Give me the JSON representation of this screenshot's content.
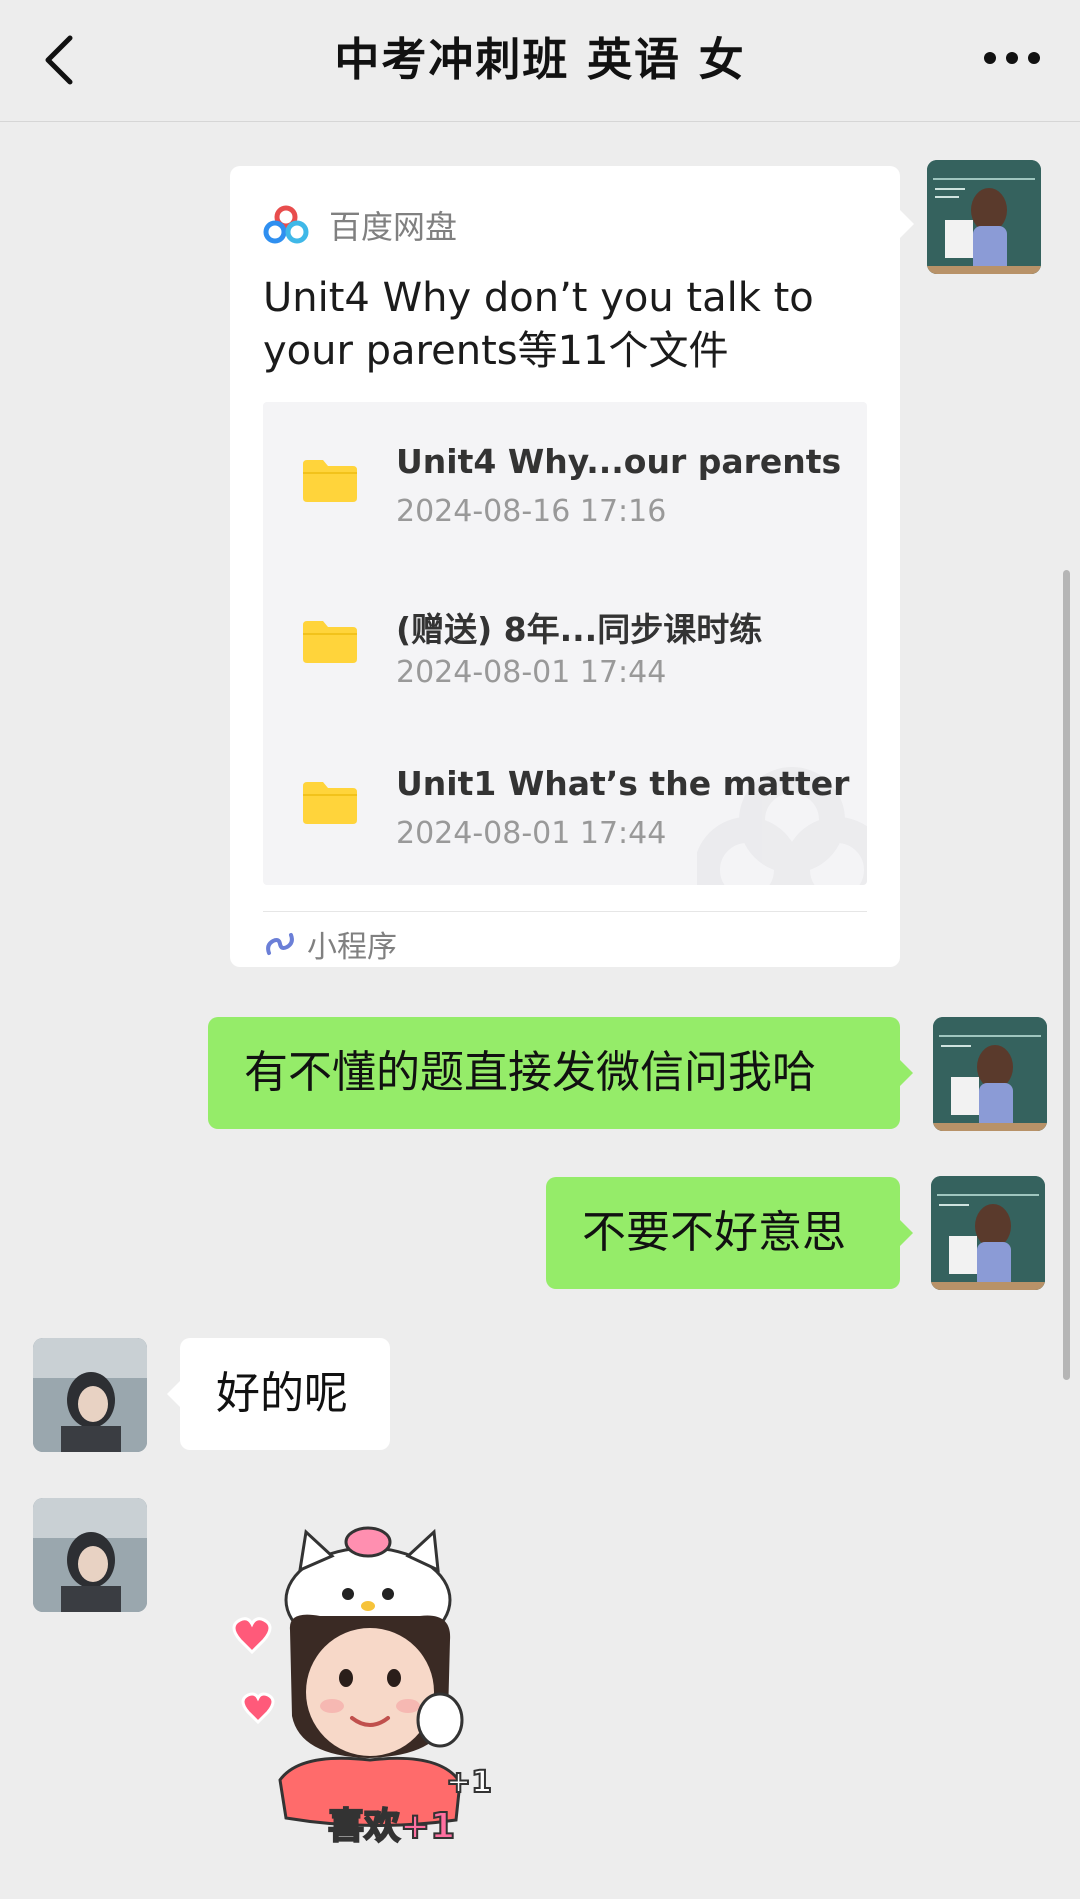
{
  "header": {
    "title": "中考冲刺班 英语 女",
    "back_icon": "chevron-left-icon",
    "more_icon": "ellipsis-icon"
  },
  "share_card": {
    "app_name": "百度网盘",
    "title": "Unit4   Why don’t you talk to your parents等11个文件",
    "files": [
      {
        "name": "Unit4   Why...our parents",
        "date": "2024-08-16 17:16"
      },
      {
        "name": "(赠送) 8年...同步课时练",
        "date": "2024-08-01 17:44"
      },
      {
        "name": "Unit1  What’s the matter",
        "date": "2024-08-01 17:44"
      }
    ],
    "footer_label": "小程序"
  },
  "messages": [
    {
      "side": "right",
      "text": "有不懂的题直接发微信问我哈"
    },
    {
      "side": "right",
      "text": "不要不好意思"
    },
    {
      "side": "left",
      "text": "好的呢"
    }
  ],
  "sticker": {
    "text_small": "+1",
    "text_big": "喜欢+1"
  },
  "colors": {
    "background": "#ededed",
    "bubble_green": "#95ec69",
    "bubble_white": "#ffffff",
    "folder_yellow": "#ffd43b"
  }
}
